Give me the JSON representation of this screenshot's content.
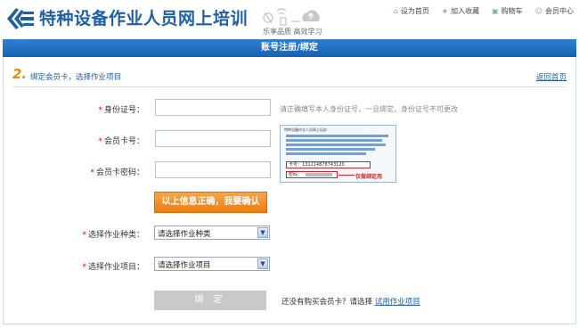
{
  "header": {
    "site_title": "特种设备作业人员网上培训",
    "slogan": "乐享品质 高效学习",
    "links": [
      {
        "label": "设为首页",
        "icon": "home-icon"
      },
      {
        "label": "加入收藏",
        "icon": "star-icon"
      },
      {
        "label": "购物车",
        "icon": "cart-icon"
      },
      {
        "label": "会员中心",
        "icon": "user-icon"
      }
    ]
  },
  "titlebar": {
    "title": "账号注册/绑定"
  },
  "step": {
    "number": "2.",
    "text": "绑定会员卡，选择作业项目",
    "return_link": "返回首页"
  },
  "form": {
    "id_label": "身份证号：",
    "card_label": "会员卡号：",
    "pwd_label": "会员卡密码：",
    "id_hint": "请正确填写本人身份证号，一旦绑定，身份证号不可更改",
    "id_value": "",
    "card_value": "",
    "pwd_value": "",
    "confirm_button": "以上信息正确，我要确认",
    "type_label": "选择作业种类：",
    "type_selected": "请选择作业种类",
    "item_label": "选择作业项目：",
    "item_selected": "请选择作业项目",
    "bind_button": "绑 定",
    "no_card_text": "还没有购买会员卡？请选择",
    "trial_link": "试用作业项目"
  },
  "card_sample": {
    "header": "特种设备作业人员网上培训",
    "card_no": "卡号：131214878743120",
    "pwd_label": "密码：",
    "note": "仅做绑定用"
  },
  "colors": {
    "brand_blue": "#1e5fa8",
    "accent_orange": "#ec7d12",
    "required_red": "#e00000"
  }
}
